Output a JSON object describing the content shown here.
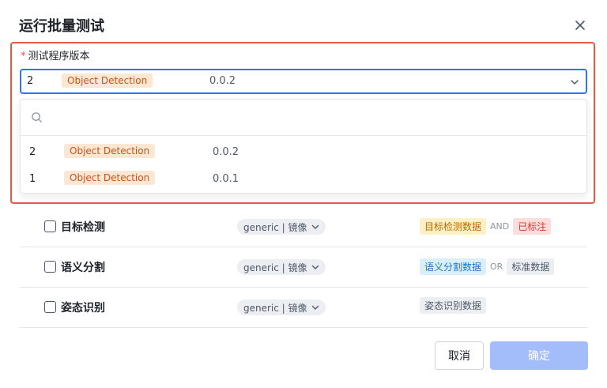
{
  "dialog": {
    "title": "运行批量测试",
    "close_icon": "close-icon"
  },
  "field": {
    "required_mark": "*",
    "label": "测试程序版本"
  },
  "select": {
    "selected": {
      "num": "2",
      "tag": "Object Detection",
      "version": "0.0.2"
    },
    "chevron_icon": "chevron-down-icon"
  },
  "dropdown": {
    "search_placeholder": "",
    "search_icon": "search-icon",
    "options": [
      {
        "num": "2",
        "tag": "Object Detection",
        "version": "0.0.2"
      },
      {
        "num": "1",
        "tag": "Object Detection",
        "version": "0.0.1"
      }
    ]
  },
  "tasks": [
    {
      "name": "目标检测",
      "image": "generic | 镜像",
      "tags": [
        "目标检测数据",
        "AND",
        "已标注"
      ]
    },
    {
      "name": "语义分割",
      "image": "generic | 镜像",
      "tags": [
        "语义分割数据",
        "OR",
        "标准数据"
      ]
    },
    {
      "name": "姿态识别",
      "image": "generic | 镜像",
      "tags": [
        "姿态识别数据"
      ]
    }
  ],
  "footer": {
    "cancel_label": "取消",
    "ok_label": "确定"
  },
  "colors": {
    "highlight": "#e8583f",
    "focus": "#3370ff",
    "primary_disabled": "#a3bdfa"
  }
}
